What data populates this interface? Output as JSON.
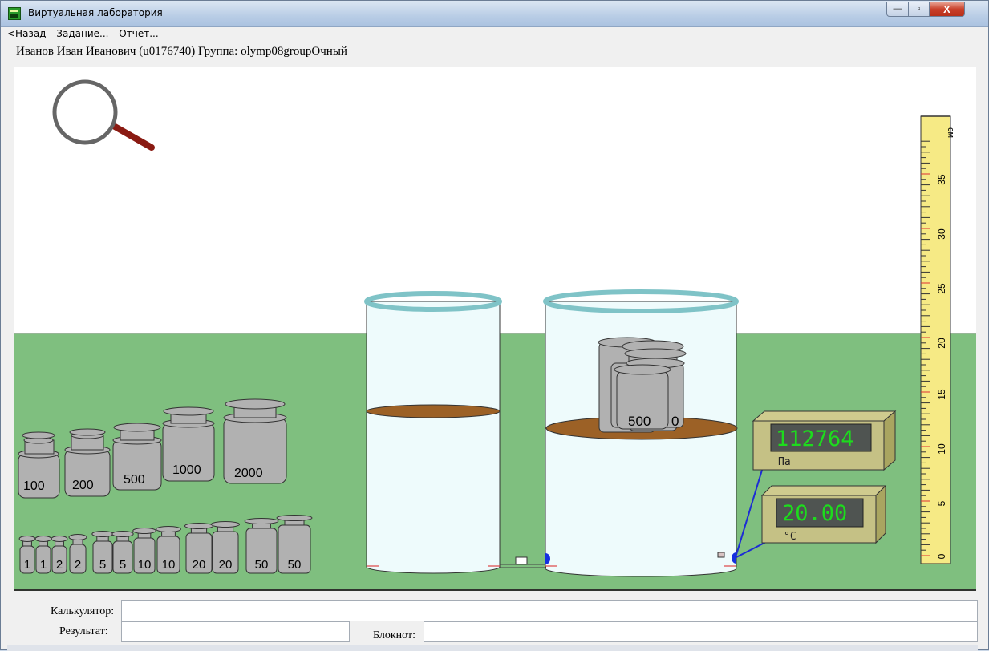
{
  "window": {
    "title": "Виртуальная лаборатория",
    "buttons": {
      "minimize": "—",
      "maximize": "▫",
      "close": "X"
    }
  },
  "menu": {
    "back": "<Назад",
    "task": "Задание...",
    "report": "Отчет..."
  },
  "user": {
    "line": "Иванов Иван Иванович (u0176740)  Группа: olymp08groupОчный"
  },
  "scene": {
    "colors": {
      "table": "#7fbf7f",
      "glass": "#eefbfc",
      "rim": "#7fc3c7",
      "piston": "#9c6126",
      "weight": "#b1b1b1",
      "meter": "#c5c185",
      "ruler": "#f6ea85",
      "lcd_text": "#1ddc1d"
    },
    "large_weights": [
      "100",
      "200",
      "500",
      "1000",
      "2000"
    ],
    "small_weights": [
      "1",
      "1",
      "2",
      "2",
      "5",
      "5",
      "10",
      "10",
      "20",
      "20",
      "50",
      "50"
    ],
    "weights_on_piston": {
      "label": "500",
      "hidden_suffix": "0"
    },
    "pressure_meter": {
      "value": "112764",
      "unit": "Па"
    },
    "thermometer": {
      "value": "20.00",
      "unit": "°C"
    },
    "ruler": {
      "unit": "см",
      "labels": [
        "35",
        "30",
        "25",
        "20",
        "15",
        "10",
        "5",
        "0"
      ]
    },
    "magnifier_icon": "magnifier-icon"
  },
  "form": {
    "calculator_label": "Калькулятор:",
    "calculator_value": "",
    "result_label": "Результат:",
    "result_value": "",
    "notebook_label": "Блокнот:",
    "notebook_value": ""
  }
}
